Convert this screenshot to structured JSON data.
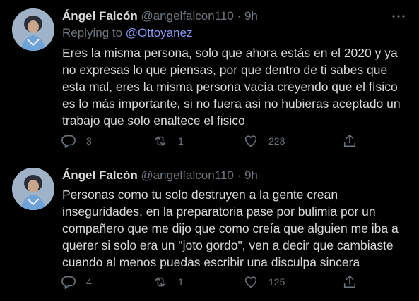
{
  "tweets": [
    {
      "author_name": "Ángel Falcón",
      "handle": "@angelfalcon110",
      "separator": "·",
      "time": "9h",
      "replying_label": "Replying to",
      "replying_to": "@Ottoyanez",
      "text": "Eres la misma persona, solo que ahora estás en el 2020 y ya no expresas lo que piensas, por que dentro de ti sabes que esta mal, eres la misma persona vacía creyendo que el físico es lo más importante, si no fuera asi no hubieras aceptado un trabajo que solo enaltece el fisico",
      "replies": "3",
      "retweets": "1",
      "likes": "228"
    },
    {
      "author_name": "Ángel Falcón",
      "handle": "@angelfalcon110",
      "separator": "·",
      "time": "9h",
      "text": "Personas como tu solo destruyen a la gente crean inseguridades, en la preparatoria pase por bulimia por un compañero que me dijo que como creía que alguien me iba a querer si solo era un  \"joto gordo\", ven a decir que cambiaste cuando al menos puedas escribir una disculpa sincera",
      "replies": "4",
      "retweets": "1",
      "likes": "125"
    }
  ],
  "colors": {
    "background": "#000000",
    "text": "#d9d9d9",
    "muted": "#6e767d",
    "mention": "#8b99f5",
    "divider": "#2f3336"
  },
  "icons": [
    "more-icon",
    "reply-icon",
    "retweet-icon",
    "like-icon",
    "share-icon"
  ]
}
